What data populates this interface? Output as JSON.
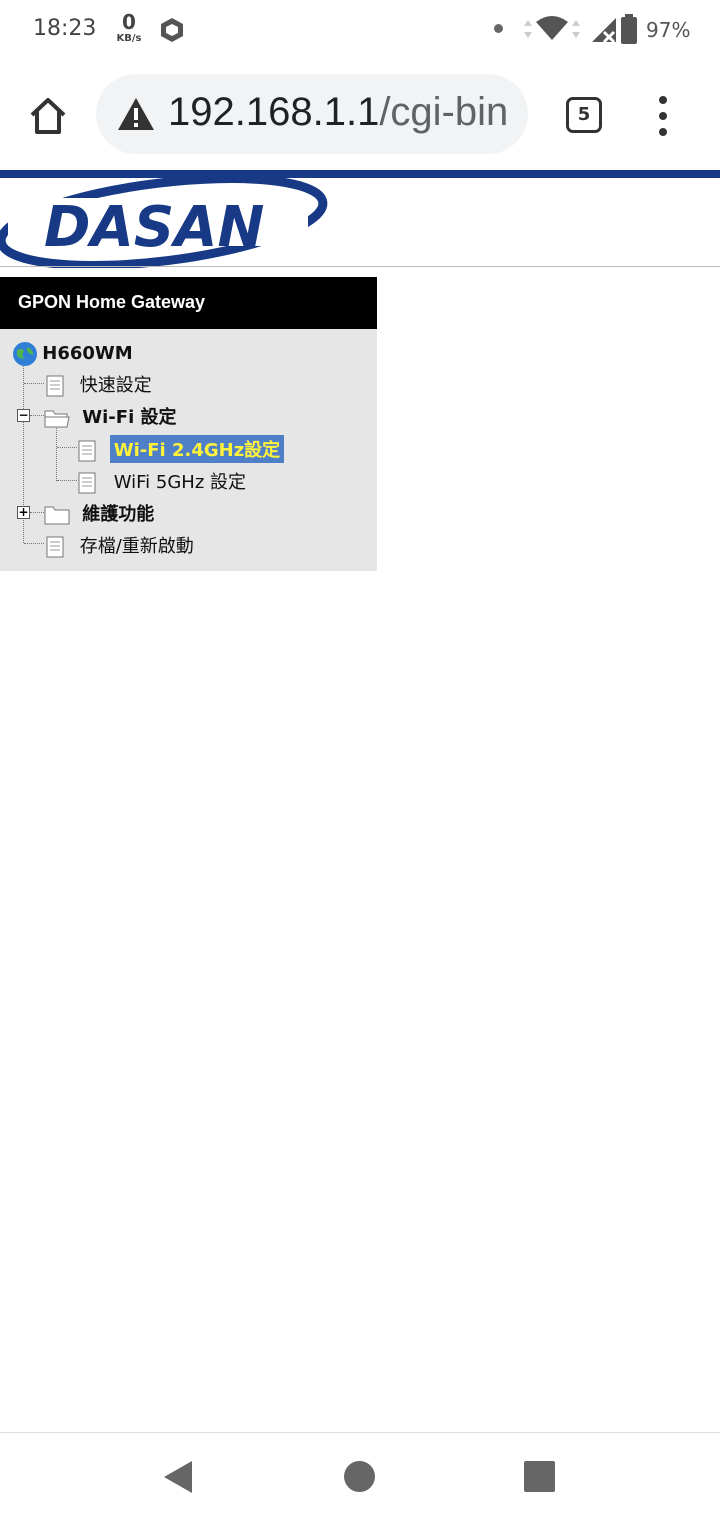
{
  "status_bar": {
    "time": "18:23",
    "net_speed_value": "0",
    "net_speed_unit": "KB/s",
    "battery_percent": "97%",
    "icons": [
      "shield-icon",
      "notification-dot-icon",
      "wifi-icon",
      "signal-icon",
      "battery-icon"
    ]
  },
  "browser": {
    "url_host": "192.168.1.1",
    "url_path": "/cgi-bin",
    "tab_count": "5",
    "security_icon": "warning-icon"
  },
  "page": {
    "brand": "DASAN",
    "menu_title": "GPON Home Gateway",
    "tree": {
      "root": "H660WM",
      "items": [
        {
          "label": "快速設定",
          "type": "page"
        },
        {
          "label": "Wi-Fi 設定",
          "type": "folder-open"
        },
        {
          "label": "Wi-Fi 2.4GHz設定",
          "type": "page",
          "selected": true
        },
        {
          "label": "WiFi 5GHz 設定",
          "type": "page"
        },
        {
          "label": "維護功能",
          "type": "folder-closed"
        },
        {
          "label": "存檔/重新啟動",
          "type": "page"
        }
      ]
    },
    "colors": {
      "brand_blue": "#183a86",
      "selected_bg": "#4f7fc6",
      "selected_text": "#fff23b",
      "menu_header_bg": "#000000",
      "tree_bg": "#e6e6e6"
    }
  },
  "nav": {
    "icons": [
      "back-icon",
      "home-circle-icon",
      "recent-apps-icon"
    ]
  }
}
